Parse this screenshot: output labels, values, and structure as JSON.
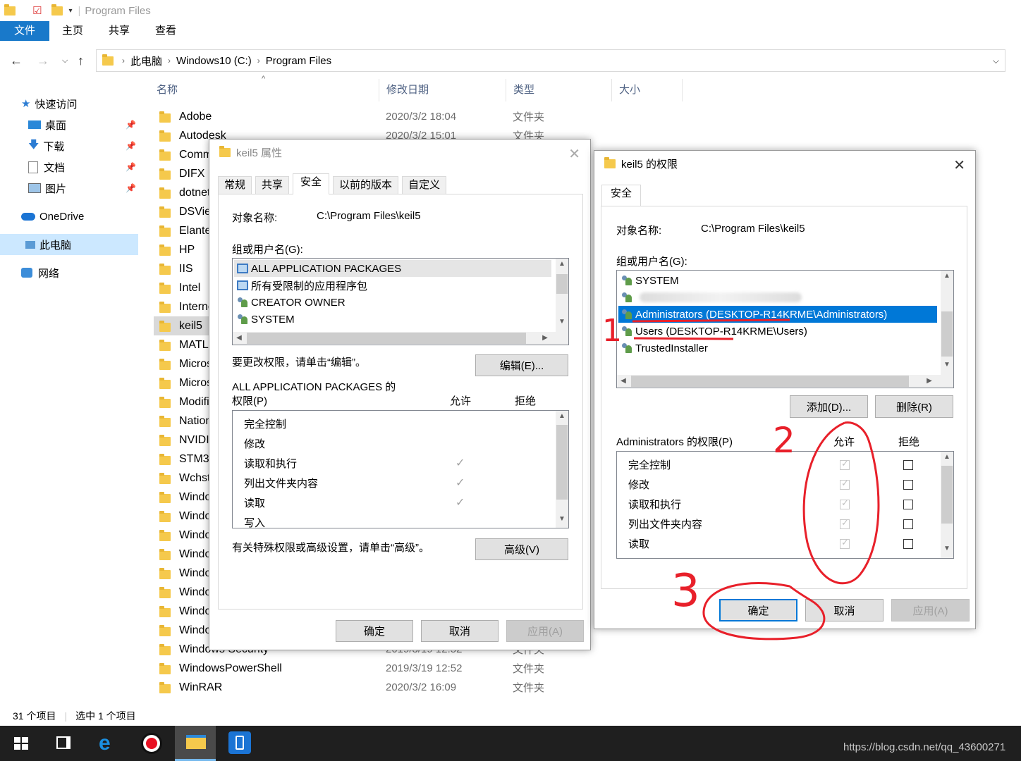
{
  "window": {
    "title": "Program Files"
  },
  "ribbon": {
    "tabs": [
      "文件",
      "主页",
      "共享",
      "查看"
    ]
  },
  "address": {
    "crumbs": [
      "此电脑",
      "Windows10 (C:)",
      "Program Files"
    ]
  },
  "nav": {
    "quick": "快速访问",
    "desktop": "桌面",
    "downloads": "下载",
    "docs": "文档",
    "pics": "图片",
    "onedrive": "OneDrive",
    "pc": "此电脑",
    "network": "网络"
  },
  "columns": {
    "name": "名称",
    "date": "修改日期",
    "type": "类型",
    "size": "大小"
  },
  "files": [
    {
      "name": "Adobe",
      "date": "2020/3/2 18:04",
      "type": "文件夹"
    },
    {
      "name": "Autodesk",
      "date": "2020/3/2 15:01",
      "type": "文件夹"
    },
    {
      "name": "Comm",
      "date": "",
      "type": ""
    },
    {
      "name": "DIFX",
      "date": "",
      "type": ""
    },
    {
      "name": "dotnet",
      "date": "",
      "type": ""
    },
    {
      "name": "DSView",
      "date": "",
      "type": ""
    },
    {
      "name": "Elantec",
      "date": "",
      "type": ""
    },
    {
      "name": "HP",
      "date": "",
      "type": ""
    },
    {
      "name": "IIS",
      "date": "",
      "type": ""
    },
    {
      "name": "Intel",
      "date": "",
      "type": ""
    },
    {
      "name": "Interne",
      "date": "",
      "type": ""
    },
    {
      "name": "keil5",
      "date": "",
      "type": ""
    },
    {
      "name": "MATLA",
      "date": "",
      "type": ""
    },
    {
      "name": "Micros",
      "date": "",
      "type": ""
    },
    {
      "name": "Micros",
      "date": "",
      "type": ""
    },
    {
      "name": "Modifi",
      "date": "",
      "type": ""
    },
    {
      "name": "Nation",
      "date": "",
      "type": ""
    },
    {
      "name": "NVIDIA",
      "date": "",
      "type": ""
    },
    {
      "name": "STM32",
      "date": "",
      "type": ""
    },
    {
      "name": "Wchstr",
      "date": "",
      "type": ""
    },
    {
      "name": "Windo",
      "date": "",
      "type": ""
    },
    {
      "name": "Windo",
      "date": "",
      "type": ""
    },
    {
      "name": "Windo",
      "date": "",
      "type": ""
    },
    {
      "name": "Windo",
      "date": "",
      "type": ""
    },
    {
      "name": "Windo",
      "date": "",
      "type": ""
    },
    {
      "name": "Windo",
      "date": "",
      "type": ""
    },
    {
      "name": "Windo",
      "date": "",
      "type": ""
    },
    {
      "name": "Windo",
      "date": "",
      "type": ""
    },
    {
      "name": "Windows Security",
      "date": "2019/3/19 12:52",
      "type": "文件夹"
    },
    {
      "name": "WindowsPowerShell",
      "date": "2019/3/19 12:52",
      "type": "文件夹"
    },
    {
      "name": "WinRAR",
      "date": "2020/3/2 16:09",
      "type": "文件夹"
    }
  ],
  "status": {
    "count": "31 个项目",
    "selected": "选中 1 个项目"
  },
  "props": {
    "title": "keil5 属性",
    "tabs": [
      "常规",
      "共享",
      "安全",
      "以前的版本",
      "自定义"
    ],
    "obj_label": "对象名称:",
    "obj_value": "C:\\Program Files\\keil5",
    "group_label": "组或用户名(G):",
    "users": [
      "ALL APPLICATION PACKAGES",
      "所有受限制的应用程序包",
      "CREATOR OWNER",
      "SYSTEM"
    ],
    "edit_hint": "要更改权限，请单击“编辑”。",
    "edit_btn": "编辑(E)...",
    "perm_label1": "ALL APPLICATION PACKAGES 的",
    "perm_label2": "权限(P)",
    "allow": "允许",
    "deny": "拒绝",
    "perms": [
      "完全控制",
      "修改",
      "读取和执行",
      "列出文件夹内容",
      "读取",
      "写入"
    ],
    "adv_hint": "有关特殊权限或高级设置，请单击“高级”。",
    "adv_btn": "高级(V)",
    "ok": "确定",
    "cancel": "取消",
    "apply": "应用(A)"
  },
  "perm": {
    "title": "keil5 的权限",
    "tab": "安全",
    "obj_label": "对象名称:",
    "obj_value": "C:\\Program Files\\keil5",
    "group_label": "组或用户名(G):",
    "users": [
      "SYSTEM",
      "",
      "Administrators (DESKTOP-R14KRME\\Administrators)",
      "Users (DESKTOP-R14KRME\\Users)",
      "TrustedInstaller"
    ],
    "add_btn": "添加(D)...",
    "remove_btn": "删除(R)",
    "perm_label": "Administrators 的权限(P)",
    "allow": "允许",
    "deny": "拒绝",
    "perms": [
      "完全控制",
      "修改",
      "读取和执行",
      "列出文件夹内容",
      "读取"
    ],
    "ok": "确定",
    "cancel": "取消",
    "apply": "应用(A)"
  },
  "annotations": {
    "n1": "1",
    "n2": "2",
    "n3": "3"
  },
  "watermark": "https://blog.csdn.net/qq_43600271",
  "colors": {
    "accent": "#0078d7",
    "file_tab": "#1979ca",
    "taskbar": "#1f1f1f",
    "annotation": "#e8202a"
  }
}
